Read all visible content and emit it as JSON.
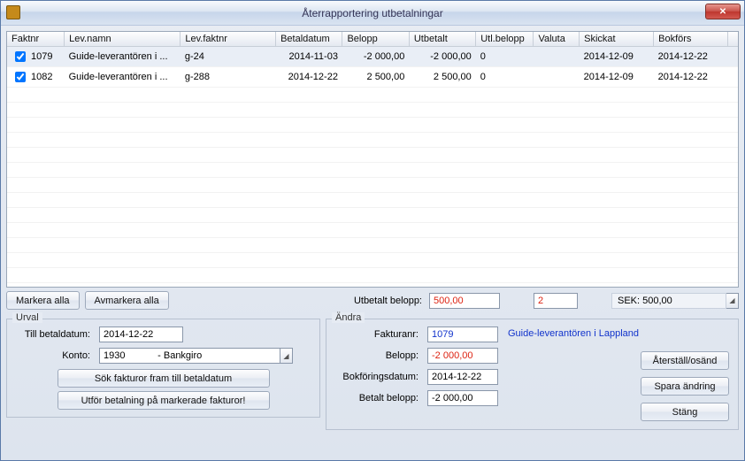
{
  "window": {
    "title": "Återrapportering utbetalningar"
  },
  "grid": {
    "headers": {
      "faktnr": "Faktnr",
      "levnamn": "Lev.namn",
      "levfaktnr": "Lev.faktnr",
      "betaldatum": "Betaldatum",
      "belopp": "Belopp",
      "utbetalt": "Utbetalt",
      "utlbelopp": "Utl.belopp",
      "valuta": "Valuta",
      "skickat": "Skickat",
      "bokfors": "Bokförs"
    },
    "rows": [
      {
        "checked": true,
        "faktnr": "1079",
        "levnamn": "Guide-leverantören i ...",
        "levfaktnr": "g-24",
        "betaldatum": "2014-11-03",
        "belopp": "-2 000,00",
        "utbetalt": "-2 000,00",
        "utlbelopp": "0",
        "valuta": "",
        "skickat": "2014-12-09",
        "bokfors": "2014-12-22"
      },
      {
        "checked": true,
        "faktnr": "1082",
        "levnamn": "Guide-leverantören i ...",
        "levfaktnr": "g-288",
        "betaldatum": "2014-12-22",
        "belopp": "2 500,00",
        "utbetalt": "2 500,00",
        "utlbelopp": "0",
        "valuta": "",
        "skickat": "2014-12-09",
        "bokfors": "2014-12-22"
      }
    ]
  },
  "topButtons": {
    "mark_all": "Markera alla",
    "unmark_all": "Avmarkera alla"
  },
  "utbetalt": {
    "label": "Utbetalt belopp:",
    "amount": "500,00",
    "count": "2",
    "status": "SEK: 500,00"
  },
  "urval": {
    "title": "Urval",
    "till_betaldatum_label": "Till betaldatum:",
    "till_betaldatum": "2014-12-22",
    "konto_label": "Konto:",
    "konto": "1930            - Bankgiro",
    "search_btn": "Sök fakturor fram till betaldatum",
    "exec_btn": "Utför betalning på markerade fakturor!"
  },
  "andra": {
    "title": "Ändra",
    "fakturanr_label": "Fakturanr:",
    "fakturanr": "1079",
    "supplier": "Guide-leverantören i Lappland",
    "belopp_label": "Belopp:",
    "belopp": "-2 000,00",
    "bokf_label": "Bokföringsdatum:",
    "bokf": "2014-12-22",
    "betalt_label": "Betalt belopp:",
    "betalt": "-2 000,00",
    "reset_btn": "Återställ/osänd",
    "save_btn": "Spara ändring",
    "close_btn": "Stäng"
  }
}
